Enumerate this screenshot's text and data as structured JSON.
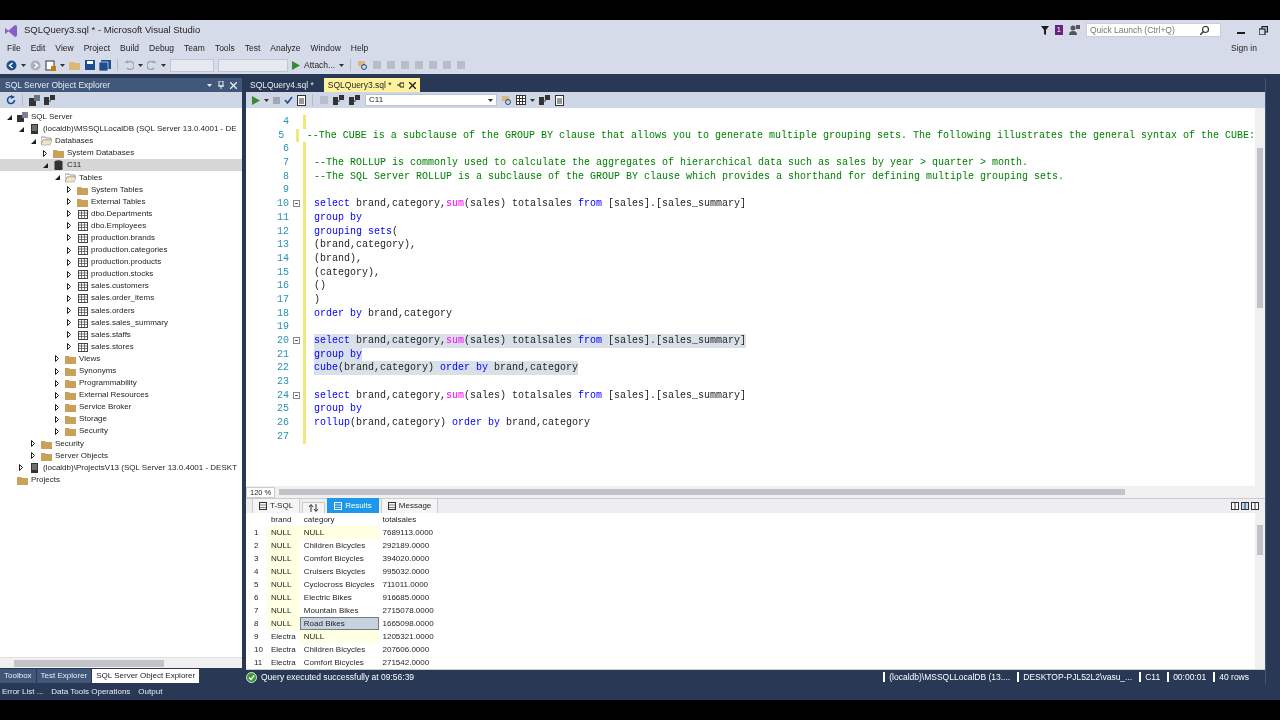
{
  "window": {
    "title": "SQLQuery3.sql * - Microsoft Visual Studio",
    "notification_count": "1",
    "quick_launch": {
      "placeholder": "Quick Launch (Ctrl+Q)"
    },
    "sign_in": "Sign in"
  },
  "menu": [
    "File",
    "Edit",
    "View",
    "Project",
    "Build",
    "Debug",
    "Team",
    "Tools",
    "Test",
    "Analyze",
    "Window",
    "Help"
  ],
  "toolbar": {
    "attach_button": "Attach..."
  },
  "explorer": {
    "title": "SQL Server Object Explorer",
    "tree": [
      {
        "label": "SQL Server",
        "kind": "server",
        "expanded": true,
        "selected": false,
        "children": [
          {
            "label": "(localdb)\\MSSQLLocalDB (SQL Server 13.0.4001 - DE",
            "kind": "instance",
            "expanded": true,
            "selected": false,
            "children": [
              {
                "label": "Databases",
                "kind": "folder-open",
                "expanded": true,
                "selected": false,
                "children": [
                  {
                    "label": "System Databases",
                    "kind": "folder",
                    "expanded": false,
                    "selected": false
                  },
                  {
                    "label": "C11",
                    "kind": "database",
                    "expanded": true,
                    "selected": true,
                    "children": [
                      {
                        "label": "Tables",
                        "kind": "folder-open",
                        "expanded": true,
                        "selected": false,
                        "children": [
                          {
                            "label": "System Tables",
                            "kind": "folder",
                            "expanded": false,
                            "selected": false
                          },
                          {
                            "label": "External Tables",
                            "kind": "folder",
                            "expanded": false,
                            "selected": false
                          },
                          {
                            "label": "dbo.Departments",
                            "kind": "table",
                            "expanded": false,
                            "selected": false
                          },
                          {
                            "label": "dbo.Employees",
                            "kind": "table",
                            "expanded": false,
                            "selected": false
                          },
                          {
                            "label": "production.brands",
                            "kind": "table",
                            "expanded": false,
                            "selected": false
                          },
                          {
                            "label": "production.categories",
                            "kind": "table",
                            "expanded": false,
                            "selected": false
                          },
                          {
                            "label": "production.products",
                            "kind": "table",
                            "expanded": false,
                            "selected": false
                          },
                          {
                            "label": "production.stocks",
                            "kind": "table",
                            "expanded": false,
                            "selected": false
                          },
                          {
                            "label": "sales.customers",
                            "kind": "table",
                            "expanded": false,
                            "selected": false
                          },
                          {
                            "label": "sales.order_items",
                            "kind": "table",
                            "expanded": false,
                            "selected": false
                          },
                          {
                            "label": "sales.orders",
                            "kind": "table",
                            "expanded": false,
                            "selected": false
                          },
                          {
                            "label": "sales.sales_summary",
                            "kind": "table",
                            "expanded": false,
                            "selected": false
                          },
                          {
                            "label": "sales.staffs",
                            "kind": "table",
                            "expanded": false,
                            "selected": false
                          },
                          {
                            "label": "sales.stores",
                            "kind": "table",
                            "expanded": false,
                            "selected": false
                          }
                        ]
                      },
                      {
                        "label": "Views",
                        "kind": "folder",
                        "expanded": false,
                        "selected": false
                      },
                      {
                        "label": "Synonyms",
                        "kind": "folder",
                        "expanded": false,
                        "selected": false
                      },
                      {
                        "label": "Programmability",
                        "kind": "folder",
                        "expanded": false,
                        "selected": false
                      },
                      {
                        "label": "External Resources",
                        "kind": "folder",
                        "expanded": false,
                        "selected": false
                      },
                      {
                        "label": "Service Broker",
                        "kind": "folder",
                        "expanded": false,
                        "selected": false
                      },
                      {
                        "label": "Storage",
                        "kind": "folder",
                        "expanded": false,
                        "selected": false
                      },
                      {
                        "label": "Security",
                        "kind": "folder",
                        "expanded": false,
                        "selected": false
                      }
                    ]
                  }
                ]
              },
              {
                "label": "Security",
                "kind": "folder",
                "expanded": false,
                "selected": false
              },
              {
                "label": "Server Objects",
                "kind": "folder",
                "expanded": false,
                "selected": false
              }
            ]
          },
          {
            "label": "(localdb)\\ProjectsV13 (SQL Server 13.0.4001 - DESKT",
            "kind": "instance",
            "expanded": false,
            "selected": false
          }
        ]
      },
      {
        "label": "Projects",
        "kind": "folder",
        "selected": false
      }
    ],
    "bottom_tabs": [
      {
        "label": "Toolbox",
        "selected": false
      },
      {
        "label": "Test Explorer",
        "selected": false
      },
      {
        "label": "SQL Server Object Explorer",
        "selected": true
      }
    ]
  },
  "doc_tabs": [
    {
      "label": "SQLQuery4.sql *",
      "selected": false
    },
    {
      "label": "SQLQuery3.sql *",
      "selected": true
    }
  ],
  "editor_toolbar": {
    "database": "C11"
  },
  "lines": [
    {
      "number": "4"
    },
    {
      "number": "5",
      "highlighted": false,
      "tokens": [
        {
          "kind": "comment",
          "text": "--The CUBE is a subclause of the GROUP BY clause that allows you to generate multiple grouping sets. The following illustrates the general syntax of the CUBE:"
        }
      ]
    },
    {
      "number": "6"
    },
    {
      "number": "7",
      "highlighted": false,
      "tokens": [
        {
          "kind": "comment",
          "text": "--The ROLLUP is commonly used to calculate the aggregates of hierarchical data such as sales by year > quarter > month."
        }
      ]
    },
    {
      "number": "8",
      "highlighted": false,
      "tokens": [
        {
          "kind": "comment",
          "text": "--The SQL Server ROLLUP is a subclause of the GROUP BY clause which provides a shorthand for defining multiple grouping sets."
        }
      ]
    },
    {
      "number": "9"
    },
    {
      "number": "10",
      "highlighted": false,
      "fold": true,
      "tokens": [
        {
          "kind": "keyword",
          "text": "select"
        },
        {
          "kind": "plain",
          "text": " brand,category,"
        },
        {
          "kind": "function",
          "text": "sum"
        },
        {
          "kind": "plain",
          "text": "(sales) totalsales "
        },
        {
          "kind": "keyword",
          "text": "from"
        },
        {
          "kind": "plain",
          "text": " [sales].[sales_summary]"
        }
      ]
    },
    {
      "number": "11",
      "highlighted": false,
      "tokens": [
        {
          "kind": "keyword",
          "text": "group by"
        }
      ]
    },
    {
      "number": "12",
      "highlighted": false,
      "tokens": [
        {
          "kind": "keyword",
          "text": "grouping sets"
        },
        {
          "kind": "plain",
          "text": "("
        }
      ]
    },
    {
      "number": "13",
      "highlighted": false,
      "tokens": [
        {
          "kind": "plain",
          "text": "(brand,category),"
        }
      ]
    },
    {
      "number": "14",
      "highlighted": false,
      "tokens": [
        {
          "kind": "plain",
          "text": "(brand),"
        }
      ]
    },
    {
      "number": "15",
      "highlighted": false,
      "tokens": [
        {
          "kind": "plain",
          "text": "(category),"
        }
      ]
    },
    {
      "number": "16",
      "highlighted": false,
      "tokens": [
        {
          "kind": "plain",
          "text": "()"
        }
      ]
    },
    {
      "number": "17",
      "highlighted": false,
      "tokens": [
        {
          "kind": "plain",
          "text": ")"
        }
      ]
    },
    {
      "number": "18",
      "highlighted": false,
      "tokens": [
        {
          "kind": "keyword",
          "text": "order by"
        },
        {
          "kind": "plain",
          "text": " brand,category"
        }
      ]
    },
    {
      "number": "19"
    },
    {
      "number": "20",
      "highlighted": true,
      "fold": true,
      "tokens": [
        {
          "kind": "keyword",
          "text": "select"
        },
        {
          "kind": "plain",
          "text": " brand,category,"
        },
        {
          "kind": "function",
          "text": "sum"
        },
        {
          "kind": "plain",
          "text": "(sales) totalsales "
        },
        {
          "kind": "keyword",
          "text": "from"
        },
        {
          "kind": "plain",
          "text": " [sales].[sales_summary]"
        }
      ]
    },
    {
      "number": "21",
      "highlighted": true,
      "tokens": [
        {
          "kind": "keyword",
          "text": "group by"
        }
      ]
    },
    {
      "number": "22",
      "highlighted": true,
      "tokens": [
        {
          "kind": "keyword",
          "text": "cube"
        },
        {
          "kind": "plain",
          "text": "(brand,category) "
        },
        {
          "kind": "keyword",
          "text": "order by"
        },
        {
          "kind": "plain",
          "text": " brand,category"
        }
      ]
    },
    {
      "number": "23"
    },
    {
      "number": "24",
      "highlighted": false,
      "fold": true,
      "tokens": [
        {
          "kind": "keyword",
          "text": "select"
        },
        {
          "kind": "plain",
          "text": " brand,category,"
        },
        {
          "kind": "function",
          "text": "sum"
        },
        {
          "kind": "plain",
          "text": "(sales) totalsales "
        },
        {
          "kind": "keyword",
          "text": "from"
        },
        {
          "kind": "plain",
          "text": " [sales].[sales_summary]"
        }
      ]
    },
    {
      "number": "25",
      "highlighted": false,
      "tokens": [
        {
          "kind": "keyword",
          "text": "group by"
        }
      ]
    },
    {
      "number": "26",
      "highlighted": false,
      "tokens": [
        {
          "kind": "keyword",
          "text": "rollup"
        },
        {
          "kind": "plain",
          "text": "(brand,category) "
        },
        {
          "kind": "keyword",
          "text": "order by"
        },
        {
          "kind": "plain",
          "text": " brand,category"
        }
      ]
    },
    {
      "number": "27"
    }
  ],
  "zoom_level": "120 %",
  "result_tabs": [
    {
      "label": "T-SQL",
      "kind": "text",
      "selected": false
    },
    {
      "kind": "sort",
      "selected": false
    },
    {
      "label": "Results",
      "kind": "text",
      "selected": true
    },
    {
      "label": "Message",
      "kind": "text",
      "selected": false
    }
  ],
  "results": {
    "columns": [
      "brand",
      "category",
      "totalsales"
    ],
    "rows": [
      {
        "number": "1",
        "cells": [
          {
            "text": "NULL",
            "null": true,
            "selected": false
          },
          {
            "text": "NULL",
            "null": true,
            "selected": false
          },
          {
            "text": "7689113.0000",
            "null": false,
            "selected": false
          }
        ]
      },
      {
        "number": "2",
        "cells": [
          {
            "text": "NULL",
            "null": true,
            "selected": false
          },
          {
            "text": "Children Bicycles",
            "null": false,
            "selected": false
          },
          {
            "text": "292189.0000",
            "null": false,
            "selected": false
          }
        ]
      },
      {
        "number": "3",
        "cells": [
          {
            "text": "NULL",
            "null": true,
            "selected": false
          },
          {
            "text": "Comfort Bicycles",
            "null": false,
            "selected": false
          },
          {
            "text": "394020.0000",
            "null": false,
            "selected": false
          }
        ]
      },
      {
        "number": "4",
        "cells": [
          {
            "text": "NULL",
            "null": true,
            "selected": false
          },
          {
            "text": "Cruisers Bicycles",
            "null": false,
            "selected": false
          },
          {
            "text": "995032.0000",
            "null": false,
            "selected": false
          }
        ]
      },
      {
        "number": "5",
        "cells": [
          {
            "text": "NULL",
            "null": true,
            "selected": false
          },
          {
            "text": "Cyclocross Bicycles",
            "null": false,
            "selected": false
          },
          {
            "text": "711011.0000",
            "null": false,
            "selected": false
          }
        ]
      },
      {
        "number": "6",
        "cells": [
          {
            "text": "NULL",
            "null": true,
            "selected": false
          },
          {
            "text": "Electric Bikes",
            "null": false,
            "selected": false
          },
          {
            "text": "916685.0000",
            "null": false,
            "selected": false
          }
        ]
      },
      {
        "number": "7",
        "cells": [
          {
            "text": "NULL",
            "null": true,
            "selected": false
          },
          {
            "text": "Mountain Bikes",
            "null": false,
            "selected": false
          },
          {
            "text": "2715078.0000",
            "null": false,
            "selected": false
          }
        ]
      },
      {
        "number": "8",
        "cells": [
          {
            "text": "NULL",
            "null": true,
            "selected": false
          },
          {
            "text": "Road Bikes",
            "null": false,
            "selected": true
          },
          {
            "text": "1665098.0000",
            "null": false,
            "selected": false
          }
        ]
      },
      {
        "number": "9",
        "cells": [
          {
            "text": "Electra",
            "null": false,
            "selected": false
          },
          {
            "text": "NULL",
            "null": true,
            "selected": false
          },
          {
            "text": "1205321.0000",
            "null": false,
            "selected": false
          }
        ]
      },
      {
        "number": "10",
        "cells": [
          {
            "text": "Electra",
            "null": false,
            "selected": false
          },
          {
            "text": "Children Bicycles",
            "null": false,
            "selected": false
          },
          {
            "text": "207606.0000",
            "null": false,
            "selected": false
          }
        ]
      },
      {
        "number": "11",
        "cells": [
          {
            "text": "Electra",
            "null": false,
            "selected": false
          },
          {
            "text": "Comfort Bicycles",
            "null": false,
            "selected": false
          },
          {
            "text": "271542.0000",
            "null": false,
            "selected": false
          }
        ]
      }
    ]
  },
  "status_bar": {
    "message": "Query executed successfully at 09:56:39",
    "segments": [
      "(localdb)\\MSSQLLocalDB (13....",
      "DESKTOP-PJL52L2\\vasu_...",
      "C11",
      "00:00:01",
      "40 rows"
    ]
  },
  "output_tabs": [
    "Error List ...",
    "Data Tools Operations",
    "Output"
  ]
}
